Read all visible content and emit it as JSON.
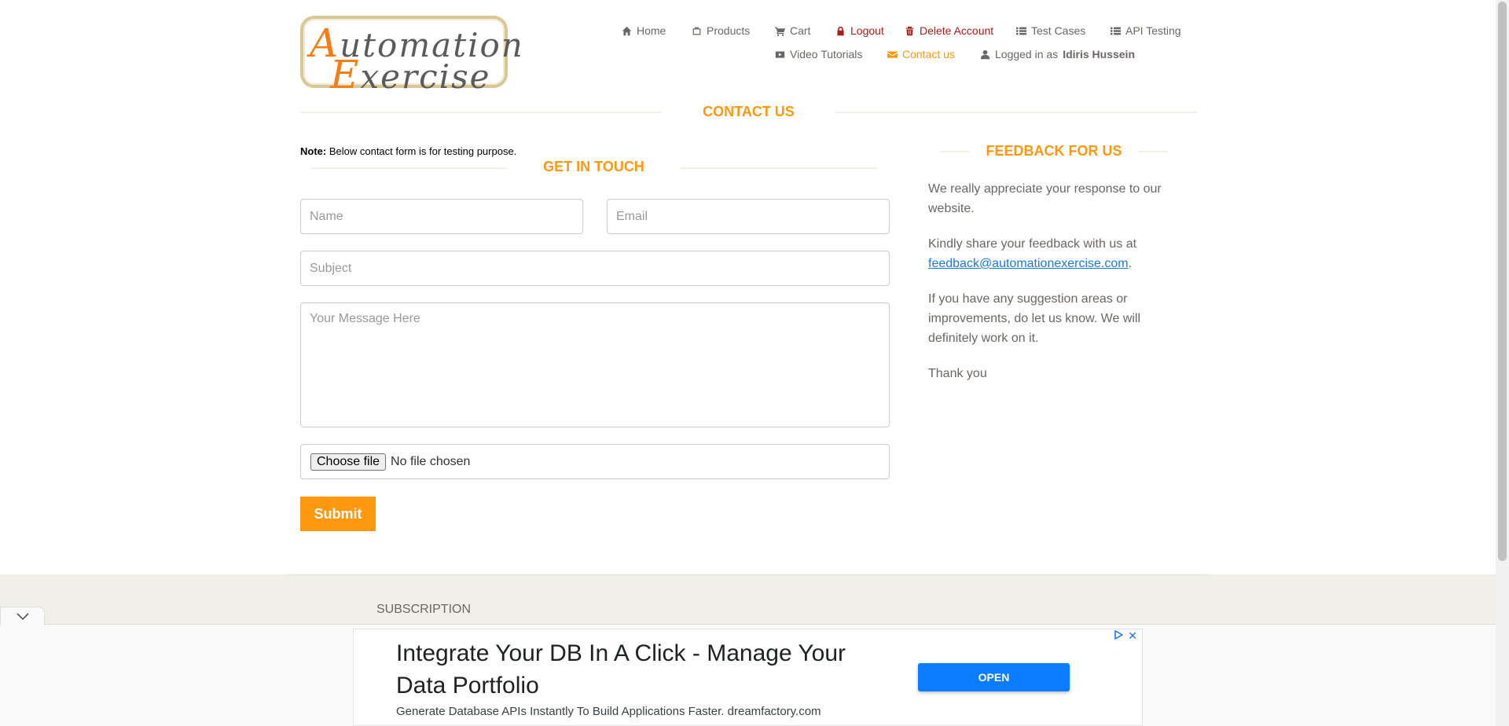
{
  "logo": {
    "line1_cap": "A",
    "line1_rest": "utomation",
    "line2_cap": "E",
    "line2_rest": "xercise"
  },
  "nav": {
    "home": "Home",
    "products": "Products",
    "cart": "Cart",
    "logout": "Logout",
    "delete_account": "Delete Account",
    "test_cases": "Test Cases",
    "api_testing": "API Testing",
    "video_tutorials": "Video Tutorials",
    "contact_us": "Contact us",
    "logged_in_prefix": "Logged in as",
    "logged_in_user": "Idiris Hussein"
  },
  "page_title": "CONTACT US",
  "note": {
    "label": "Note:",
    "text": "Below contact form is for testing purpose."
  },
  "form": {
    "title": "GET IN TOUCH",
    "name_placeholder": "Name",
    "email_placeholder": "Email",
    "subject_placeholder": "Subject",
    "message_placeholder": "Your Message Here",
    "file_button": "Choose file",
    "file_status": "No file chosen",
    "submit_label": "Submit"
  },
  "feedback": {
    "title": "FEEDBACK FOR US",
    "para1": "We really appreciate your response to our website.",
    "para2_prefix": "Kindly share your feedback with us at",
    "email": "feedback@automationexercise.com",
    "para2_suffix": ".",
    "para3": "If you have any suggestion areas or improvements, do let us know. We will definitely work on it.",
    "para4": "Thank you"
  },
  "footer": {
    "subscription": "SUBSCRIPTION"
  },
  "ad": {
    "headline": "Integrate Your DB In A Click - Manage Your Data Portfolio",
    "description": "Generate Database APIs Instantly To Build Applications Faster. dreamfactory.com",
    "cta": "OPEN",
    "close": "✕"
  },
  "colors": {
    "accent": "#fe980f",
    "danger": "#a51d1d",
    "link": "#1c7ad4",
    "ad_button": "#0b7bff"
  }
}
